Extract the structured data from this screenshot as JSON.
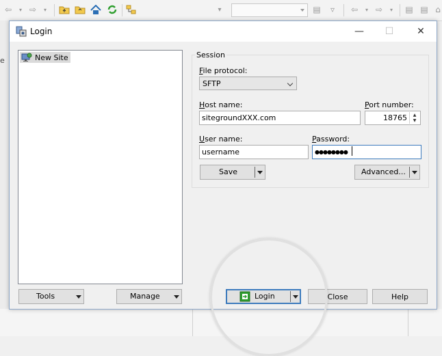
{
  "dialog": {
    "title": "Login",
    "window_controls": {
      "minimize": "—",
      "maximize": "☐",
      "close": "✕"
    }
  },
  "site_tree": {
    "items": [
      {
        "label": "New Site",
        "icon": "monitor-globe-icon"
      }
    ]
  },
  "session": {
    "group_label": "Session",
    "file_protocol": {
      "label_mnemonic": "F",
      "label_rest": "ile protocol:",
      "value": "SFTP"
    },
    "host_name": {
      "label_mnemonic": "H",
      "label_rest": "ost name:",
      "value": "sitegroundXXX.com"
    },
    "port_number": {
      "label_mnemonic": "P",
      "label_rest": "ort number:",
      "value": "18765"
    },
    "user_name": {
      "label_mnemonic": "U",
      "label_rest": "ser name:",
      "value": "username"
    },
    "password": {
      "label_mnemonic": "P",
      "label_rest": "assword:",
      "value": "●●●●●●●●"
    },
    "save_button": "Save",
    "advanced_button": "Advanced..."
  },
  "footer": {
    "tools_button": "Tools",
    "manage_button": "Manage",
    "login_button": "Login",
    "close_button": "Close",
    "help_button": "Help"
  },
  "colors": {
    "focus_border": "#3d7bbd",
    "login_icon_green": "#2e9e2e"
  }
}
